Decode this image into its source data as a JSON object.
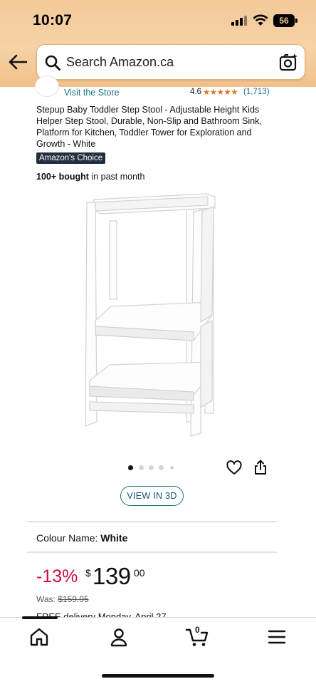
{
  "status_bar": {
    "time": "10:07",
    "battery": "56"
  },
  "header": {
    "search_placeholder": "Search Amazon.ca",
    "icons": [
      "back-arrow-icon",
      "search-icon",
      "camera-search-icon"
    ],
    "background_color": "#f3c999"
  },
  "store": {
    "link_text": "Visit the Store",
    "rating_value": "4.6",
    "stars_display": "★★★★★",
    "rating_count": "(1,713)"
  },
  "product": {
    "title": "Stepup Baby Toddler Step Stool - Adjustable Height Kids Helper Step Stool, Durable, Non-Slip and Bathroom Sink, Platform for Kitchen, Toddler Tower for Exploration and Growth - White",
    "badge": "Amazon's Choice",
    "bought_bold": "100+ bought",
    "bought_rest": " in past month",
    "image_alt": "white toddler step stool",
    "carousel_total": 5,
    "carousel_active": 1,
    "view_3d_label": "VIEW IN 3D",
    "colour_label": "Colour Name: ",
    "colour_value": "White"
  },
  "price": {
    "discount": "-13%",
    "currency": "$",
    "whole": "139",
    "fraction": "00",
    "was_label": "Was: ",
    "was_value": "$159.95",
    "delivery_partial": "FREE delivery Monday, April 27"
  },
  "bottom_nav": {
    "items": [
      "home-icon",
      "account-icon",
      "cart-icon",
      "menu-icon"
    ],
    "cart_count": "0",
    "active": "home"
  },
  "colors": {
    "link": "#1a7187",
    "discount": "#cc0c39",
    "stars": "#de7921",
    "badge": "#232f3e"
  }
}
